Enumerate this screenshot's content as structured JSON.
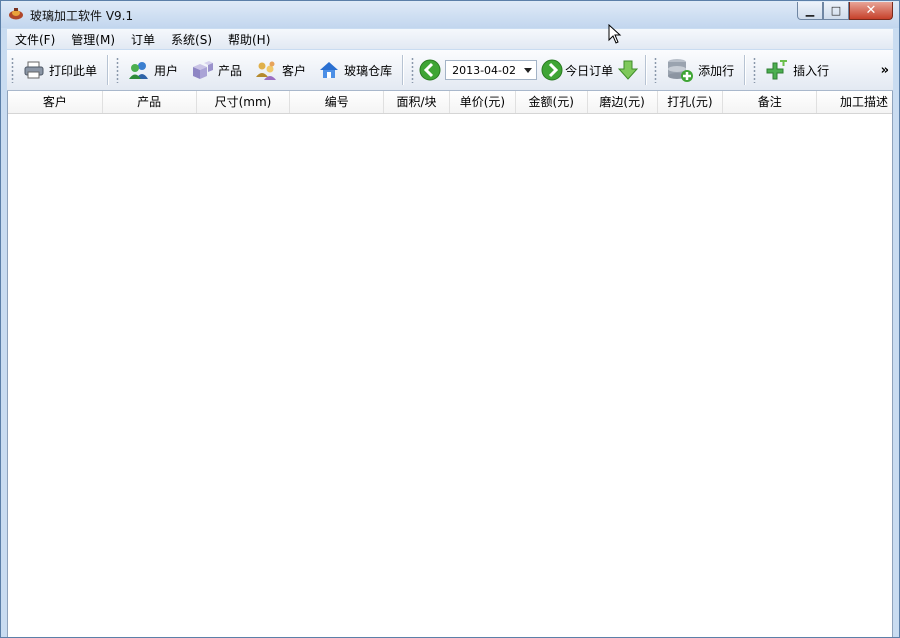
{
  "window": {
    "title": "玻璃加工软件 V9.1"
  },
  "menu": [
    {
      "label": "文件(F)"
    },
    {
      "label": "管理(M)"
    },
    {
      "label": "订单"
    },
    {
      "label": "系统(S)"
    },
    {
      "label": "帮助(H)"
    }
  ],
  "toolbar": {
    "print_label": "打印此单",
    "user_label": "用户",
    "product_label": "产品",
    "customer_label": "客户",
    "warehouse_label": "玻璃仓库",
    "date_value": "2013-04-02",
    "today_order_label": "今日订单",
    "add_row_label": "添加行",
    "insert_row_label": "插入行",
    "overflow_label": "»"
  },
  "table": {
    "columns": [
      "客户",
      "产品",
      "尺寸(mm)",
      "编号",
      "面积/块",
      "单价(元)",
      "金额(元)",
      "磨边(元)",
      "打孔(元)",
      "备注",
      "加工描述"
    ],
    "rows": []
  },
  "colors": {
    "accent_green": "#3fa535",
    "house_blue": "#2a6fd1",
    "close_red": "#c6402a"
  }
}
